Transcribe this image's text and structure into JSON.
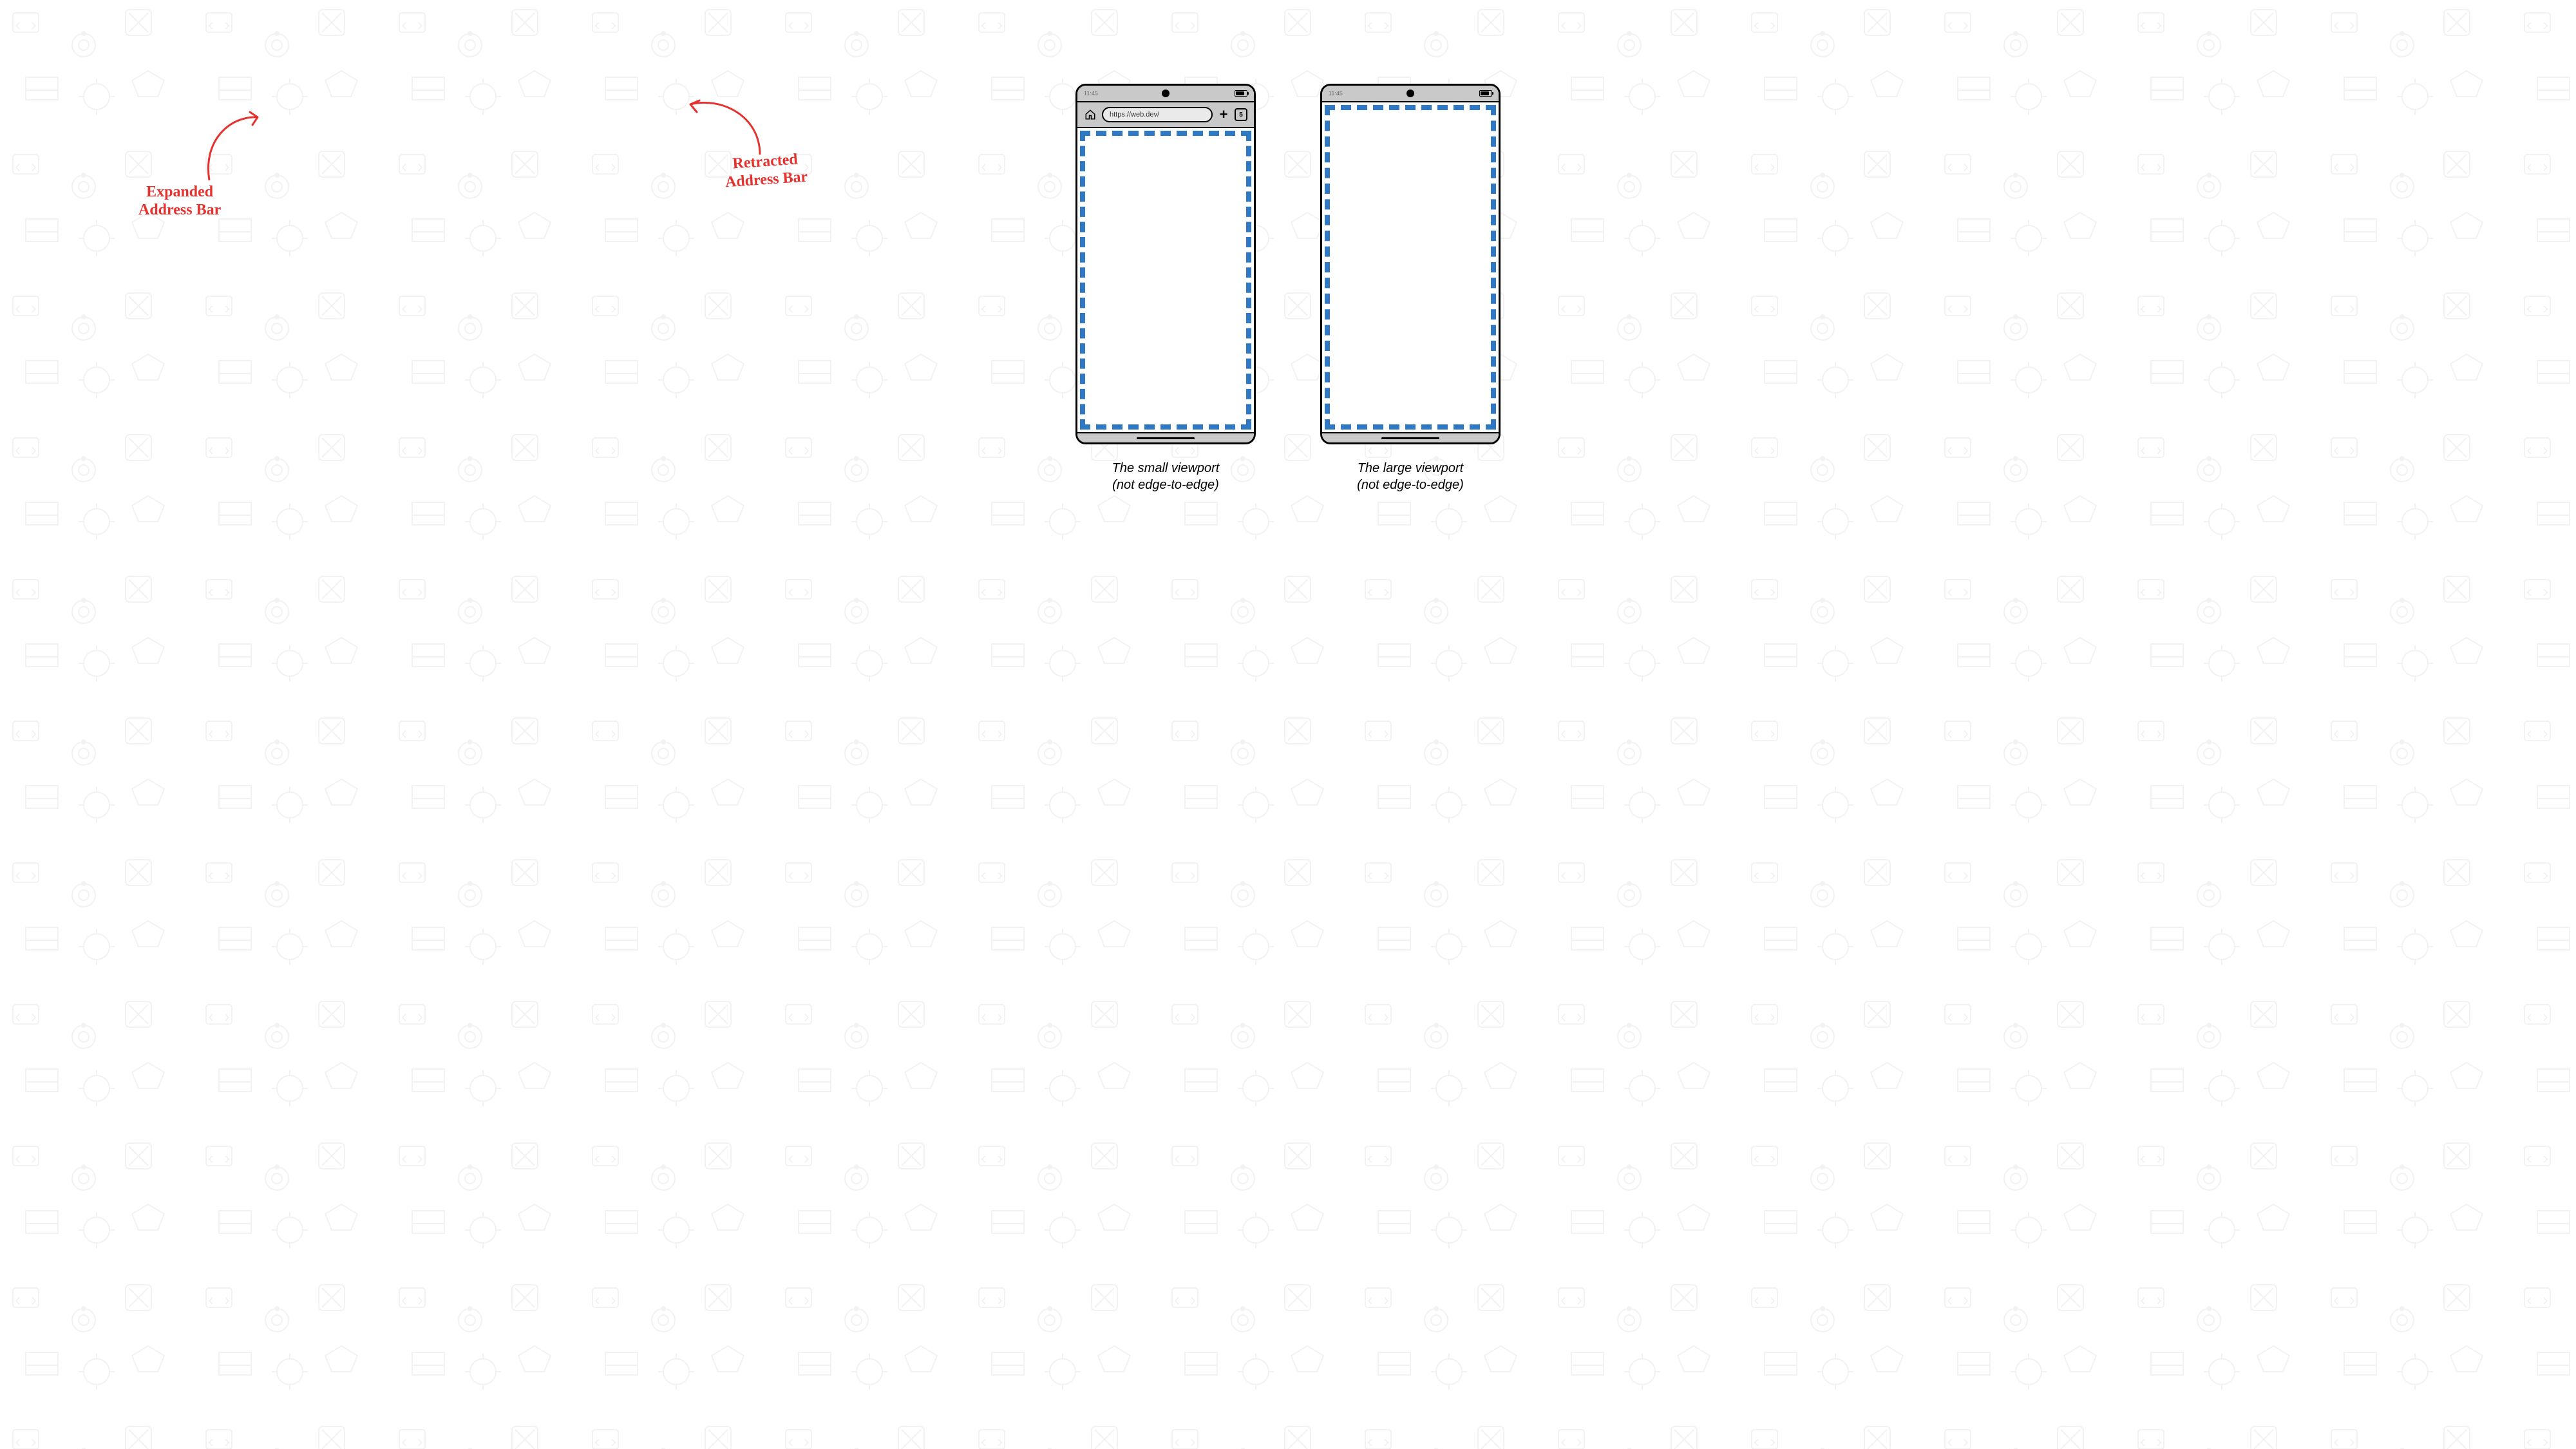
{
  "status": {
    "time": "11:45"
  },
  "addressBar": {
    "url": "https://web.dev/",
    "tabCount": "5",
    "plus": "+"
  },
  "captions": {
    "left": "The small viewport\n(not edge-to-edge)",
    "right": "The large viewport\n(not edge-to-edge)"
  },
  "annotations": {
    "left": "Expanded\nAddress Bar",
    "right": "Retracted\nAddress Bar"
  },
  "colors": {
    "dash": "#2f78c4",
    "annotation": "#e5322e",
    "chrome": "#c9c9c9"
  }
}
